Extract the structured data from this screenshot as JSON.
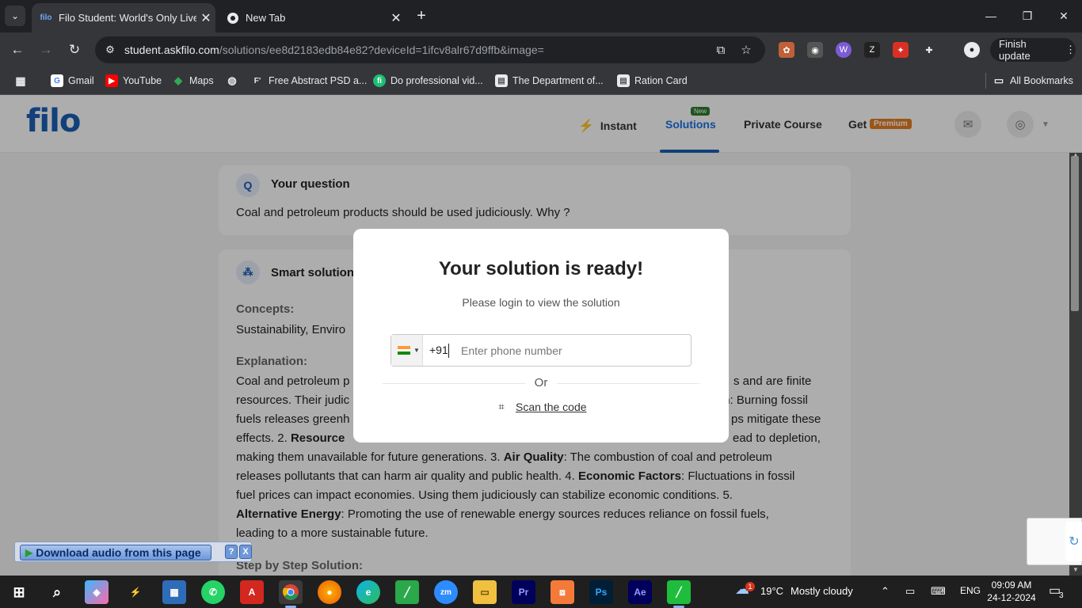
{
  "browser": {
    "tabs": [
      {
        "title": "Filo Student: World's Only Live I",
        "active": true
      },
      {
        "title": "New Tab",
        "active": false
      }
    ],
    "url_host": "student.askfilo.com",
    "url_path": "/solutions/ee8d2183edb84e82?deviceId=1ifcv8alr67d9ffb&image=",
    "finish_update": "Finish update",
    "bookmarks": [
      {
        "label": "Gmail",
        "icon": "gmail-icon"
      },
      {
        "label": "YouTube",
        "icon": "youtube-icon"
      },
      {
        "label": "Maps",
        "icon": "maps-icon"
      },
      {
        "label": "",
        "icon": "globe-icon"
      },
      {
        "label": "Free Abstract PSD a...",
        "icon": "freepik-icon"
      },
      {
        "label": "Do professional vid...",
        "icon": "fiverr-icon"
      },
      {
        "label": "The Department of...",
        "icon": "page-icon"
      },
      {
        "label": "Ration Card",
        "icon": "page-icon"
      }
    ],
    "all_bookmarks": "All Bookmarks"
  },
  "site": {
    "logo": "filo",
    "nav": {
      "instant": "Instant",
      "solutions": "Solutions",
      "solutions_badge": "New",
      "private_course": "Private Course",
      "get": "Get",
      "premium": "Premium"
    }
  },
  "question": {
    "badge": "Q",
    "heading": "Your question",
    "text": "Coal and petroleum products should be used judiciously. Why ?"
  },
  "solution": {
    "heading": "Smart solution",
    "concepts_label": "Concepts:",
    "concepts_text": "Sustainability, Enviro",
    "explanation_label": "Explanation:",
    "line1_left": "Coal and petroleum p",
    "line1_right": "s and are finite",
    "line2_left": "resources. Their judic",
    "line2_right_bold": "ion",
    "line2_right": ": Burning fossil",
    "line3_left": "fuels releases greenh",
    "line3_right": "ps mitigate these",
    "line4_a": "effects. 2. ",
    "line4_bold": "Resource",
    "line4_right": "ead to depletion,",
    "line5": "making them unavailable for future generations. 3. ",
    "line5_bold": "Air Quality",
    "line5_rest": ": The combustion of coal and petroleum",
    "line6": "releases pollutants that can harm air quality and public health. 4. ",
    "line6_bold": "Economic Factors",
    "line6_rest": ": Fluctuations in fossil",
    "line7": "fuel prices can impact economies. Using them judiciously can stabilize economic conditions. 5.",
    "line8_bold": "Alternative Energy",
    "line8_rest": ": Promoting the use of renewable energy sources reduces reliance on fossil fuels,",
    "line9": "leading to a more sustainable future.",
    "step_label": "Step by Step Solution:"
  },
  "modal": {
    "title": "Your solution is ready!",
    "subtitle": "Please login to view the solution",
    "country_code": "+91",
    "phone_placeholder": "Enter phone number",
    "or": "Or",
    "scan": "Scan the code"
  },
  "download_bar": {
    "label": "Download audio from this page",
    "help": "?",
    "close": "X"
  },
  "taskbar": {
    "weather_temp": "19°C",
    "weather_desc": "Mostly cloudy",
    "weather_alert": "1",
    "language": "ENG",
    "time": "09:09 AM",
    "date": "24-12-2024",
    "notifications": "3"
  }
}
